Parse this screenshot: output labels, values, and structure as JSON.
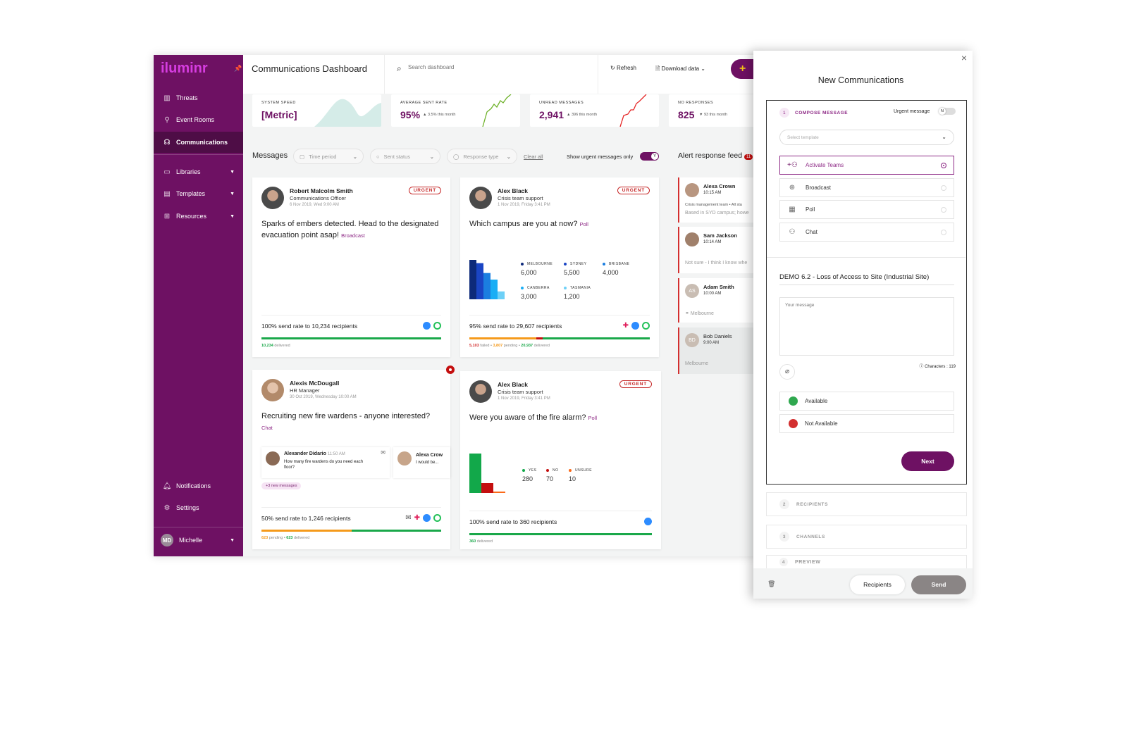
{
  "app": {
    "logo": "iluminr",
    "title": "Communications Dashboard"
  },
  "sidebar": {
    "items": [
      {
        "label": "Threats",
        "icon": "building-icon"
      },
      {
        "label": "Event Rooms",
        "icon": "location-pin-icon"
      },
      {
        "label": "Communications",
        "icon": "chat-headset-icon",
        "active": true
      },
      {
        "label": "Libraries",
        "icon": "book-icon"
      },
      {
        "label": "Templates",
        "icon": "clipboard-icon"
      },
      {
        "label": "Resources",
        "icon": "grid-icon"
      }
    ],
    "bottom": [
      {
        "label": "Notifications",
        "icon": "bell-icon"
      },
      {
        "label": "Settings",
        "icon": "gear-icon"
      }
    ],
    "user": {
      "initials": "MD",
      "name": "Michelle"
    }
  },
  "header": {
    "search_placeholder": "Search dashboard",
    "refresh": "Refresh",
    "download": "Download data",
    "add": "+"
  },
  "kpis": [
    {
      "label": "SYSTEM SPEED",
      "value": "[Metric]",
      "change": ""
    },
    {
      "label": "AVERAGE SENT RATE",
      "value": "95%",
      "change": "▲ 3.5% this month",
      "trend": "up"
    },
    {
      "label": "UNREAD MESSAGES",
      "value": "2,941",
      "change": "▲ 396 this month",
      "trend": "up"
    },
    {
      "label": "NO RESPONSES",
      "value": "825",
      "change": "▼ 93 this month",
      "trend": "down"
    }
  ],
  "filters": {
    "title": "Messages",
    "time_period": "Time period",
    "sent_status": "Sent status",
    "response_type": "Response type",
    "clear_all": "Clear all",
    "urgent_only": "Show urgent messages only",
    "urgent_toggle": "Y"
  },
  "messages": [
    {
      "name": "Robert Malcolm Smith",
      "role": "Communications Officer",
      "date": "6 Nov 2019, Wed 9:00 AM",
      "badge": "URGENT",
      "text": "Sparks of embers detected. Head to the designated evacuation point asap!",
      "type": "Broadcast",
      "rate": "100% send rate to 10,234 recipients",
      "status": [
        {
          "value": "10,234",
          "label": "delivered",
          "color": "#1aa84a"
        }
      ],
      "progress": {
        "delivered": 100
      }
    },
    {
      "name": "Alex Black",
      "role": "Crisis team support",
      "date": "1 Nov 2019, Friday 3:41 PM",
      "badge": "URGENT",
      "text": "Which campus are you at now?",
      "type": "Poll",
      "rate": "95% send rate to 29,607 recipients",
      "poll": [
        {
          "label": "MELBOURNE",
          "value": 6000,
          "display": "6,000",
          "color": "#0d2a7a"
        },
        {
          "label": "SYDNEY",
          "value": 5500,
          "display": "5,500",
          "color": "#1a45c4"
        },
        {
          "label": "BRISBANE",
          "value": 4000,
          "display": "4,000",
          "color": "#1b7ee0"
        },
        {
          "label": "CANBERRA",
          "value": 3000,
          "display": "3,000",
          "color": "#19aef5"
        },
        {
          "label": "TASMANIA",
          "value": 1200,
          "display": "1,200",
          "color": "#6dd0f7"
        }
      ],
      "status": [
        {
          "value": "5,103",
          "label": "failed",
          "color": "#d32f2f"
        },
        {
          "value": "3,807",
          "label": "pending",
          "color": "#f59a1b"
        },
        {
          "value": "20,937",
          "label": "delivered",
          "color": "#1aa84a"
        }
      ]
    },
    {
      "name": "Alexis McDougall",
      "role": "HR Manager",
      "date": "30 Oct 2019, Wednesday 10:00 AM",
      "text": "Recruiting new fire wardens - anyone interested?",
      "type": "Chat",
      "rate": "50% send rate to 1,246 recipients",
      "replies": [
        {
          "name": "Alexander Didario",
          "time": "11:50 AM",
          "text": "How many fire wardens do you need each floor?"
        },
        {
          "name": "Alexa Crow",
          "text": "I would be..."
        }
      ],
      "new_messages": "+3 new messages",
      "status": [
        {
          "value": "623",
          "label": "pending",
          "color": "#f59a1b"
        },
        {
          "value": "623",
          "label": "delivered",
          "color": "#1aa84a"
        }
      ]
    },
    {
      "name": "Alex Black",
      "role": "Crisis team support",
      "date": "1 Nov 2019, Friday 3:41 PM",
      "badge": "URGENT",
      "text": "Were you aware of the fire alarm?",
      "type": "Poll",
      "rate": "100% send rate to 360 recipients",
      "poll": [
        {
          "label": "YES",
          "value": 280,
          "display": "280",
          "color": "#12a84a"
        },
        {
          "label": "NO",
          "value": 70,
          "display": "70",
          "color": "#c40f0f"
        },
        {
          "label": "UNSURE",
          "value": 10,
          "display": "10",
          "color": "#fb6a1a"
        }
      ],
      "status": [
        {
          "value": "360",
          "label": "delivered",
          "color": "#1aa84a"
        }
      ]
    }
  ],
  "feed": {
    "title": "Alert response feed",
    "count": "11",
    "items": [
      {
        "name": "Alexa Crown",
        "time": "10:15 AM",
        "line1": "Crisis management team • All sta",
        "line2": "Based in SYD campus; howe"
      },
      {
        "name": "Sam Jackson",
        "time": "10:14 AM",
        "line2": "Not sure - I think I know whe"
      },
      {
        "initials": "AS",
        "name": "Adam Smith",
        "time": "10:00 AM",
        "line2": "Melbourne"
      },
      {
        "initials": "BD",
        "name": "Bob Daniels",
        "time": "9:00 AM",
        "line2": "Melbourne"
      }
    ]
  },
  "panel": {
    "title": "New Communications",
    "step1": {
      "num": "1",
      "label": "COMPOSE MESSAGE",
      "urgent_label": "Urgent message",
      "urgent_toggle": "N"
    },
    "template_placeholder": "Select template",
    "options": [
      {
        "label": "Activate Teams",
        "icon": "team-add-icon",
        "selected": true
      },
      {
        "label": "Broadcast",
        "icon": "broadcast-icon"
      },
      {
        "label": "Poll",
        "icon": "poll-icon"
      },
      {
        "label": "Chat",
        "icon": "chat-icon"
      }
    ],
    "subject": "DEMO 6.2 - Loss of Access to Site (Industrial Site)",
    "message_placeholder": "Your message",
    "characters": "Characters : 119",
    "responses": [
      {
        "label": "Available",
        "color": "#2fa84f"
      },
      {
        "label": "Not Available",
        "color": "#d32f2f"
      }
    ],
    "next": "Next",
    "steps": [
      {
        "num": "2",
        "label": "RECIPIENTS"
      },
      {
        "num": "3",
        "label": "CHANNELS"
      },
      {
        "num": "4",
        "label": "PREVIEW"
      }
    ],
    "recipients_btn": "Recipients",
    "send_btn": "Send"
  },
  "colors": {
    "brand": "#6e1163",
    "brand_dark": "#4e0d46",
    "urgent": "#c62828",
    "delivered": "#1aa84a",
    "pending": "#f59a1b",
    "failed": "#d32f2f"
  }
}
